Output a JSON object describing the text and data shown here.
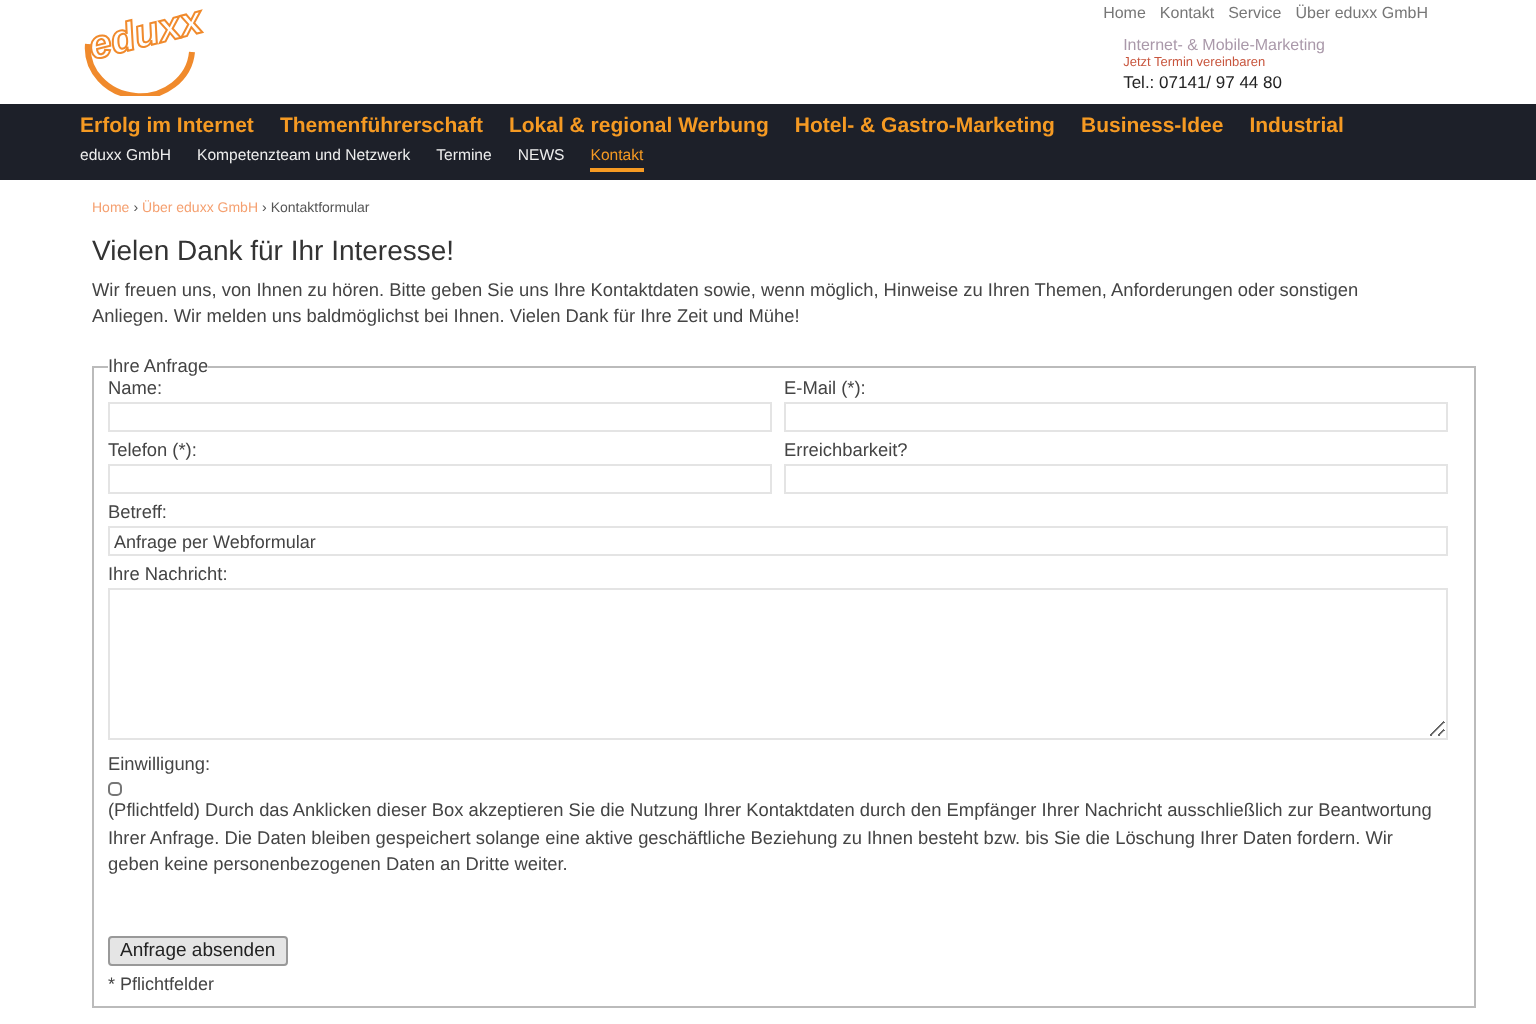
{
  "logo": "eduxx",
  "top_links": [
    "Home",
    "Kontakt",
    "Service",
    "Über eduxx GmbH"
  ],
  "tagline": "Internet- & Mobile-Marketing",
  "appointment": "Jetzt Termin vereinbaren",
  "phone": "Tel.: 07141/ 97 44 80",
  "main_nav": [
    "Erfolg im Internet",
    "Themenführerschaft",
    "Lokal & regional Werbung",
    "Hotel- & Gastro-Marketing",
    "Business-Idee",
    "Industrial"
  ],
  "sub_nav": [
    {
      "label": "eduxx GmbH",
      "selected": false
    },
    {
      "label": "Kompetenzteam und Netzwerk",
      "selected": false
    },
    {
      "label": "Termine",
      "selected": false
    },
    {
      "label": "NEWS",
      "selected": false
    },
    {
      "label": "Kontakt",
      "selected": true
    }
  ],
  "breadcrumb": [
    {
      "label": "Home",
      "kind": "link"
    },
    {
      "label": "Über eduxx GmbH",
      "kind": "link"
    },
    {
      "label": "Kontaktformular",
      "kind": "current"
    }
  ],
  "breadcrumb_separator": "›",
  "heading": "Vielen Dank für Ihr Interesse!",
  "intro": "Wir freuen uns, von Ihnen zu hören. Bitte geben Sie uns Ihre Kontaktdaten sowie, wenn möglich, Hinweise zu Ihren Themen, Anforderungen oder sonstigen Anliegen. Wir melden uns baldmöglichst bei Ihnen. Vielen Dank für Ihre Zeit und Mühe!",
  "form": {
    "legend": "Ihre Anfrage",
    "fields": [
      {
        "label": "Name:",
        "kind": "half"
      },
      {
        "label": "E-Mail (*):",
        "kind": "half"
      },
      {
        "label": "Telefon (*):",
        "kind": "half"
      },
      {
        "label": "Erreichbarkeit?",
        "kind": "half"
      },
      {
        "label": "Betreff:",
        "value": "Anfrage per Webformular",
        "kind": "full"
      },
      {
        "label": "Ihre Nachricht:",
        "kind": "textarea"
      }
    ],
    "consent_label": "Einwilligung:",
    "consent_checked": false,
    "consent_text": "(Pflichtfeld) Durch das Anklicken dieser Box akzeptieren Sie die Nutzung Ihrer Kontaktdaten durch den Empfänger Ihrer Nachricht ausschließlich zur Beantwortung Ihrer Anfrage. Die Daten bleiben gespeichert solange eine aktive geschäftliche Beziehung zu Ihnen besteht bzw. bis Sie die Löschung Ihrer Daten fordern. Wir geben keine personenbezogenen Daten an Dritte weiter.",
    "submit": "Anfrage absenden",
    "required_note": "* Pflichtfelder"
  }
}
